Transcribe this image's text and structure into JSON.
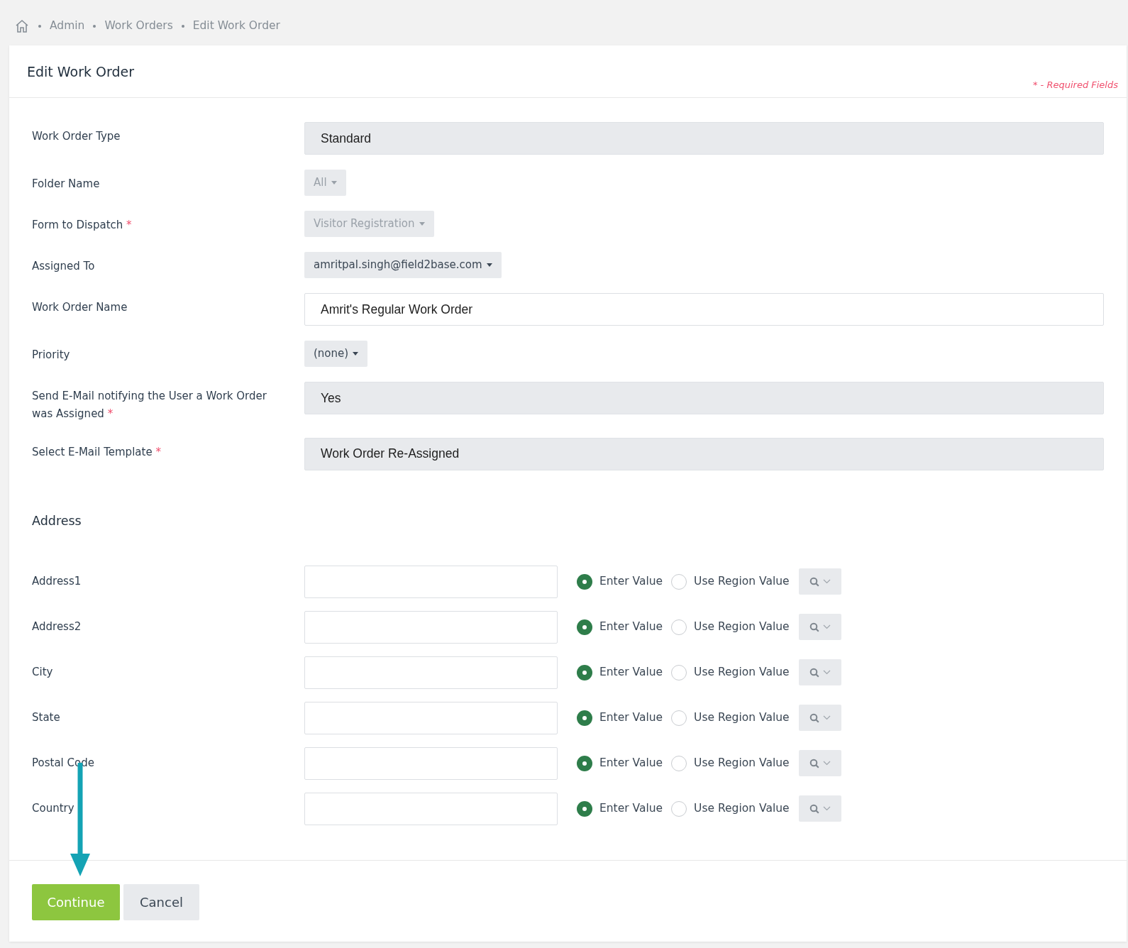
{
  "breadcrumb": [
    {
      "label": "Admin"
    },
    {
      "label": "Work Orders"
    },
    {
      "label": "Edit Work Order"
    }
  ],
  "card": {
    "title": "Edit Work Order",
    "required_note": "* - Required Fields"
  },
  "fields": [
    {
      "label": "Work Order Type",
      "kind": "readonly",
      "value": "Standard"
    },
    {
      "label": "Folder Name",
      "kind": "dropdown",
      "value": "All",
      "disabled": true
    },
    {
      "label": "Form to Dispatch",
      "required_mark": "*",
      "kind": "dropdown",
      "value": "Visitor Registration",
      "disabled": true
    },
    {
      "label": "Assigned To",
      "kind": "dropdown",
      "value": "amritpal.singh@field2base.com",
      "disabled": false
    },
    {
      "label": "Work Order Name",
      "kind": "text",
      "value": "Amrit's Regular Work Order"
    },
    {
      "label": "Priority",
      "kind": "dropdown",
      "value": "(none)",
      "disabled": false
    },
    {
      "label": "Send E-Mail notifying the User a Work Order was Assigned",
      "required_mark": "*",
      "kind": "readonly",
      "value": "Yes"
    },
    {
      "label": "Select E-Mail Template",
      "required_mark": "*",
      "kind": "readonly",
      "value": "Work Order Re-Assigned"
    }
  ],
  "address": {
    "heading": "Address",
    "rows": [
      {
        "label": "Address1",
        "options": [
          {
            "label": "Enter Value",
            "selected": true
          },
          {
            "label": "Use Region Value",
            "selected": false
          }
        ]
      },
      {
        "label": "Address2",
        "options": [
          {
            "label": "Enter Value",
            "selected": true
          },
          {
            "label": "Use Region Value",
            "selected": false
          }
        ]
      },
      {
        "label": "City",
        "options": [
          {
            "label": "Enter Value",
            "selected": true
          },
          {
            "label": "Use Region Value",
            "selected": false
          }
        ]
      },
      {
        "label": "State",
        "options": [
          {
            "label": "Enter Value",
            "selected": true
          },
          {
            "label": "Use Region Value",
            "selected": false
          }
        ]
      },
      {
        "label": "Postal Code",
        "options": [
          {
            "label": "Enter Value",
            "selected": true
          },
          {
            "label": "Use Region Value",
            "selected": false
          }
        ]
      },
      {
        "label": "Country",
        "options": [
          {
            "label": "Enter Value",
            "selected": true
          },
          {
            "label": "Use Region Value",
            "selected": false
          }
        ]
      }
    ]
  },
  "buttons": [
    {
      "label": "Continue",
      "kind": "primary"
    },
    {
      "label": "Cancel",
      "kind": "secondary"
    }
  ]
}
